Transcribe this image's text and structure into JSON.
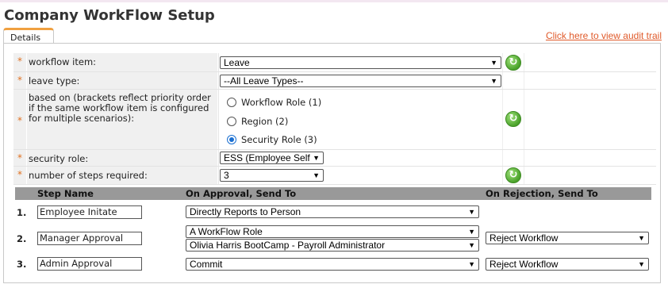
{
  "page": {
    "title": "Company WorkFlow Setup"
  },
  "tabs": {
    "details": "Details"
  },
  "links": {
    "audit": "Click here to view audit trail"
  },
  "required_marker": "*",
  "form": {
    "workflow_item": {
      "label": "workflow item:",
      "value": "Leave"
    },
    "leave_type": {
      "label": "leave type:",
      "value": "--All Leave Types--"
    },
    "based_on": {
      "label": "based on (brackets reflect priority order if the same workflow item is configured for multiple scenarios):",
      "options": [
        "Workflow Role (1)",
        "Region (2)",
        "Security Role (3)"
      ],
      "selected": "Security Role (3)"
    },
    "security_role": {
      "label": "security role:",
      "value": "ESS (Employee Self"
    },
    "num_steps": {
      "label": "number of steps required:",
      "value": "3"
    }
  },
  "steps": {
    "headers": {
      "name": "Step Name",
      "approval": "On Approval, Send To",
      "rejection": "On Rejection, Send To"
    },
    "rows": [
      {
        "num": "1.",
        "name": "Employee Initate",
        "approval": "Directly Reports to Person",
        "approval2": "",
        "rejection": ""
      },
      {
        "num": "2.",
        "name": "Manager Approval",
        "approval": "A WorkFlow Role",
        "approval2": "Olivia Harris BootCamp - Payroll Administrator",
        "rejection": "Reject Workflow"
      },
      {
        "num": "3.",
        "name": "Admin Approval",
        "approval": "Commit",
        "approval2": "",
        "rejection": "Reject Workflow"
      }
    ]
  },
  "colors": {
    "accent": "#e05a2a",
    "tab_top": "#f0a040",
    "header_bg": "#999999",
    "refresh_green": "#4aa22a"
  },
  "icons": {
    "refresh": "refresh-icon",
    "dropdown": "chevron-down-icon"
  }
}
